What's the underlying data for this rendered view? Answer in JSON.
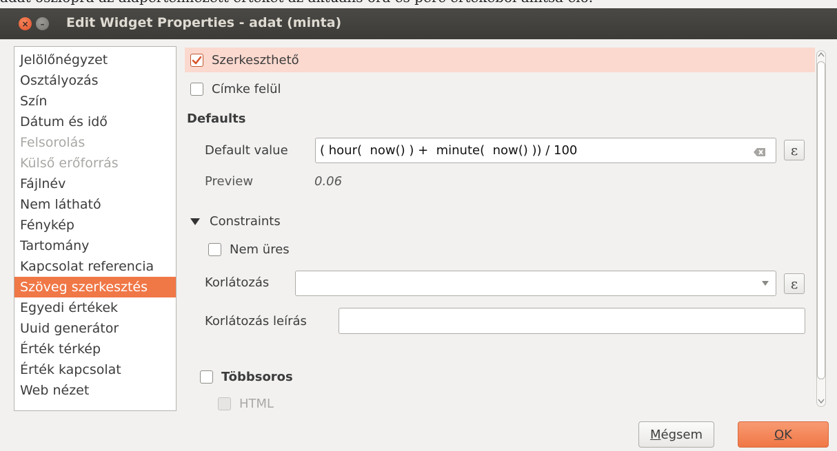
{
  "caption": "adat oszlopra az alapértelmezett értéket az aktuális óra és perc értékéből állítsa elő.",
  "window": {
    "title": "Edit Widget Properties - adat (minta)",
    "close_glyph": "×",
    "minimize_glyph": "–"
  },
  "widget_types": [
    {
      "label": "Jelölőnégyzet",
      "state": "normal"
    },
    {
      "label": "Osztályozás",
      "state": "normal"
    },
    {
      "label": "Szín",
      "state": "normal"
    },
    {
      "label": "Dátum és idő",
      "state": "normal"
    },
    {
      "label": "Felsorolás",
      "state": "disabled"
    },
    {
      "label": "Külső erőforrás",
      "state": "disabled"
    },
    {
      "label": "Fájlnév",
      "state": "normal"
    },
    {
      "label": "Nem látható",
      "state": "normal"
    },
    {
      "label": "Fénykép",
      "state": "normal"
    },
    {
      "label": "Tartomány",
      "state": "normal"
    },
    {
      "label": "Kapcsolat referencia",
      "state": "normal"
    },
    {
      "label": "Szöveg szerkesztés",
      "state": "selected"
    },
    {
      "label": "Egyedi értékek",
      "state": "normal"
    },
    {
      "label": "Uuid generátor",
      "state": "normal"
    },
    {
      "label": "Érték térkép",
      "state": "normal"
    },
    {
      "label": "Érték kapcsolat",
      "state": "normal"
    },
    {
      "label": "Web nézet",
      "state": "normal"
    }
  ],
  "settings": {
    "editable": {
      "label": "Szerkeszthető",
      "checked": true
    },
    "label_on_top": {
      "label": "Címke felül",
      "checked": false
    },
    "defaults_heading": "Defaults",
    "default_value_label": "Default value",
    "default_value": "( hour(  now() ) +  minute(  now() )) / 100",
    "preview_label": "Preview",
    "preview_value": "0.06",
    "constraints_heading": "Constraints",
    "not_null": {
      "label": "Nem üres",
      "checked": false
    },
    "constraint_label": "Korlátozás",
    "constraint_value": "",
    "constraint_desc_label": "Korlátozás leírás",
    "constraint_desc_value": "",
    "multiline": {
      "label": "Többsoros",
      "checked": false
    },
    "html": {
      "label": "HTML",
      "checked": false,
      "enabled": false
    }
  },
  "buttons": {
    "cancel": "Mégsem",
    "ok": "OK"
  },
  "colors": {
    "accent": "#f07746",
    "highlight": "#fbd9cf",
    "titlebar": "#3c3b37"
  }
}
